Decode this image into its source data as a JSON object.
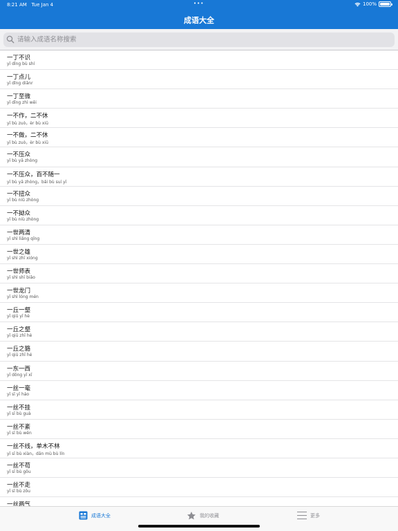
{
  "status": {
    "time": "8:21 AM",
    "date": "Tue Jan 4",
    "battery": "100%",
    "battery_level": 1.0
  },
  "nav": {
    "title": "成语大全"
  },
  "search": {
    "placeholder": "请输入成语名称搜索"
  },
  "idioms": [
    {
      "name": "一丁不识",
      "pinyin": "yī dīng bù shí"
    },
    {
      "name": "一丁点儿",
      "pinyin": "yī dīng diǎnr"
    },
    {
      "name": "一丁至微",
      "pinyin": "yī dīng zhì wēi"
    },
    {
      "name": "一不作，二不休",
      "pinyin": "yī bù zuò，èr bù xiū"
    },
    {
      "name": "一不做，二不休",
      "pinyin": "yī bù zuò，èr bù xiū"
    },
    {
      "name": "一不压众",
      "pinyin": "yī bù yā zhòng"
    },
    {
      "name": "一不压众，百不随一",
      "pinyin": "yī bù yā zhòng，bǎi bù suí yī"
    },
    {
      "name": "一不扭众",
      "pinyin": "yī bù niǔ zhòng"
    },
    {
      "name": "一不拗众",
      "pinyin": "yī bù niù zhòng"
    },
    {
      "name": "一世两清",
      "pinyin": "yī shì liǎng qīng"
    },
    {
      "name": "一世之雄",
      "pinyin": "yī shì zhī xióng"
    },
    {
      "name": "一世师表",
      "pinyin": "yī shì shī biǎo"
    },
    {
      "name": "一世龙门",
      "pinyin": "yī shì lóng mén"
    },
    {
      "name": "一丘一壑",
      "pinyin": "yī qiū yī hè"
    },
    {
      "name": "一丘之壑",
      "pinyin": "yī qiū zhī hè"
    },
    {
      "name": "一丘之貉",
      "pinyin": "yī qiū zhī hé"
    },
    {
      "name": "一东一西",
      "pinyin": "yī dōng yī xī"
    },
    {
      "name": "一丝一毫",
      "pinyin": "yī sī yī háo"
    },
    {
      "name": "一丝不挂",
      "pinyin": "yī sī bù guà"
    },
    {
      "name": "一丝不紊",
      "pinyin": "yī sī bù wěn"
    },
    {
      "name": "一丝不线，单木不林",
      "pinyin": "yī sī bù xiàn，dān mù bù lín"
    },
    {
      "name": "一丝不苟",
      "pinyin": "yī sī bù gǒu"
    },
    {
      "name": "一丝不走",
      "pinyin": "yī sī bù zǒu"
    },
    {
      "name": "一丝两气",
      "pinyin": ""
    }
  ],
  "tabs": [
    {
      "label": "成语大全",
      "icon": "idiom-book-icon",
      "active": true
    },
    {
      "label": "我的收藏",
      "icon": "star-icon",
      "active": false
    },
    {
      "label": "更多",
      "icon": "menu-lines-icon",
      "active": false
    }
  ],
  "colors": {
    "accent": "#1878d6",
    "inactive": "#8e8e93"
  }
}
